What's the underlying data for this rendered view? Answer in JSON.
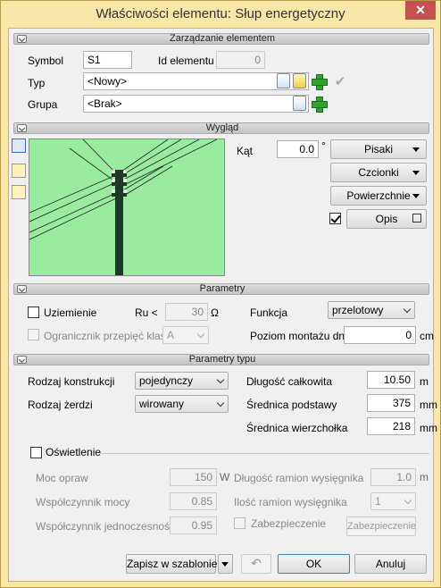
{
  "window": {
    "title": "Właściwości elementu: Słup energetyczny",
    "close_glyph": "✕"
  },
  "sections": {
    "management": "Zarządzanie elementem",
    "appearance": "Wygląd",
    "parameters": "Parametry",
    "type_parameters": "Parametry typu"
  },
  "management": {
    "symbol_label": "Symbol",
    "symbol_value": "S1",
    "id_label": "Id elementu",
    "id_value": "0",
    "type_label": "Typ",
    "type_value": "<Nowy>",
    "group_label": "Grupa",
    "group_value": "<Brak>"
  },
  "appearance": {
    "angle_label": "Kąt",
    "angle_value": "0.0",
    "angle_unit": "°",
    "pens_button": "Pisaki",
    "fonts_button": "Czcionki",
    "surfaces_button": "Powierzchnie",
    "description_button": "Opis",
    "description_checked": true,
    "preview_bg": "#99eba0"
  },
  "parameters": {
    "grounding_label": "Uziemienie",
    "ru_label": "Ru <",
    "ru_value": "30",
    "ru_unit": "Ω",
    "function_label": "Funkcja",
    "function_value": "przelotowy",
    "surge_label": "Ogranicznik przepięć klasy",
    "surge_value": "A",
    "mount_level_label": "Poziom montażu dna",
    "mount_level_value": "0",
    "mount_level_unit": "cm"
  },
  "type_parameters": {
    "construction_label": "Rodzaj konstrukcji",
    "construction_value": "pojedynczy",
    "pole_label": "Rodzaj żerdzi",
    "pole_value": "wirowany",
    "total_length_label": "Długość całkowita",
    "total_length_value": "10.50",
    "total_length_unit": "m",
    "base_diameter_label": "Średnica podstawy",
    "base_diameter_value": "375",
    "base_diameter_unit": "mm",
    "top_diameter_label": "Średnica wierzchołka",
    "top_diameter_value": "218",
    "top_diameter_unit": "mm",
    "lighting_label": "Oświetlenie",
    "fixture_power_label": "Moc opraw",
    "fixture_power_value": "150",
    "fixture_power_unit": "W",
    "arm_length_label": "Długość ramion wysięgnika",
    "arm_length_value": "1.0",
    "arm_length_unit": "m",
    "power_factor_label": "Współczynnik mocy",
    "power_factor_value": "0.85",
    "arm_count_label": "Ilość ramion wysięgnika",
    "arm_count_value": "1",
    "simultaneity_label": "Współczynnik jednoczesności",
    "simultaneity_value": "0.95",
    "protection_label": "Zabezpieczenie",
    "protection_button": "Zabezpieczenie"
  },
  "footer": {
    "save_template": "Zapisz w szablonie",
    "ok": "OK",
    "cancel": "Anuluj"
  }
}
